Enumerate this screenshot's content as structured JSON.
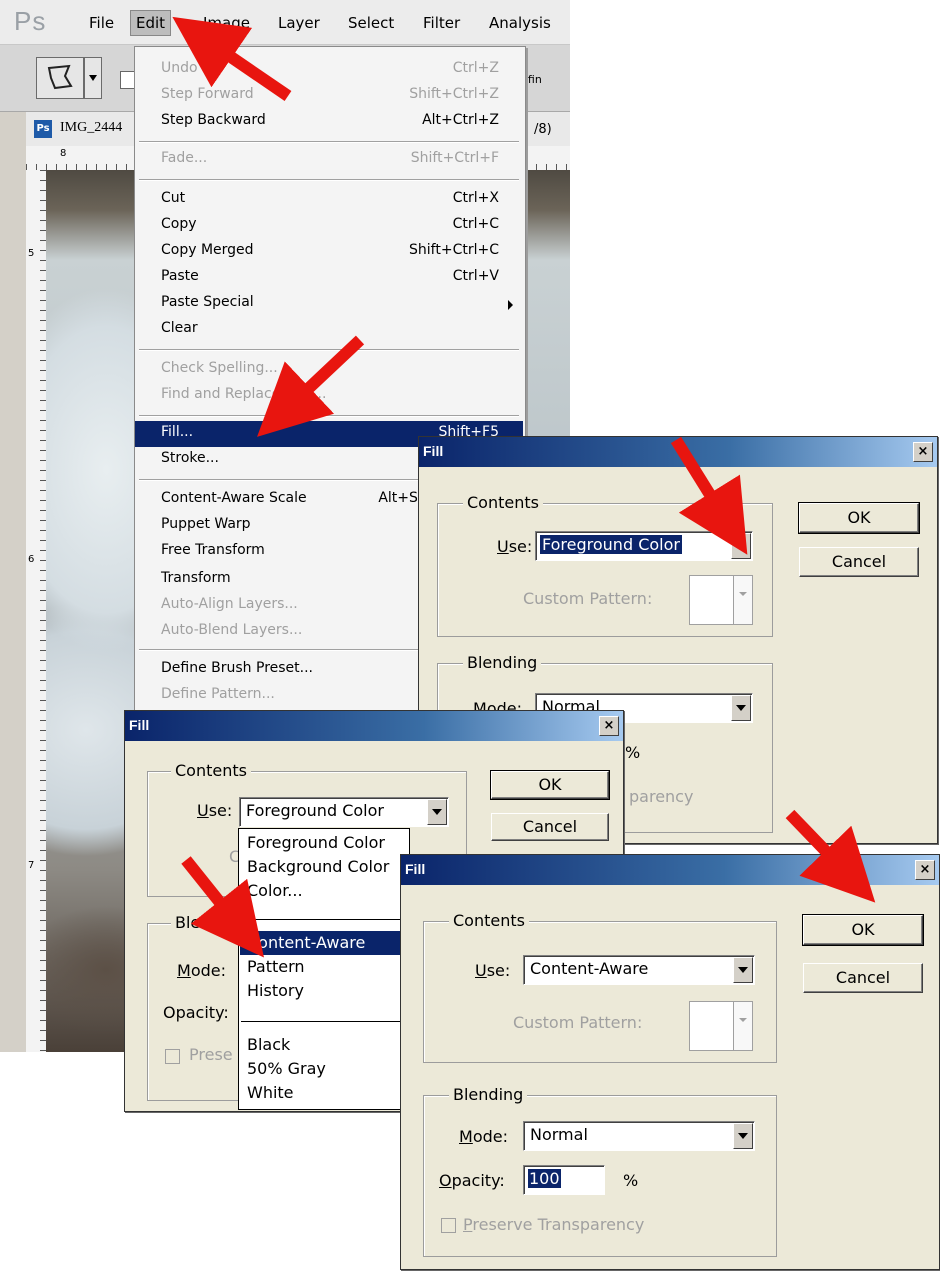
{
  "app": {
    "logo": "Ps",
    "menu": [
      "File",
      "Edit",
      "Image",
      "Layer",
      "Select",
      "Filter",
      "Analysis"
    ],
    "options_refine": "Refin",
    "doc_title": "IMG_2444",
    "doc_suffix": "/8)",
    "ruler_marks": [
      "8",
      "5",
      "6",
      "7"
    ]
  },
  "edit_menu": {
    "items": [
      {
        "label": "Undo",
        "shortcut": "Ctrl+Z",
        "disabled": true
      },
      {
        "label": "Step Forward",
        "shortcut": "Shift+Ctrl+Z",
        "disabled": true
      },
      {
        "label": "Step Backward",
        "shortcut": "Alt+Ctrl+Z",
        "disabled": false
      },
      {
        "label": "Fade...",
        "shortcut": "Shift+Ctrl+F",
        "disabled": true
      },
      {
        "label": "Cut",
        "shortcut": "Ctrl+X",
        "disabled": false
      },
      {
        "label": "Copy",
        "shortcut": "Ctrl+C",
        "disabled": false
      },
      {
        "label": "Copy Merged",
        "shortcut": "Shift+Ctrl+C",
        "disabled": false
      },
      {
        "label": "Paste",
        "shortcut": "Ctrl+V",
        "disabled": false
      },
      {
        "label": "Paste Special",
        "shortcut": "",
        "disabled": false
      },
      {
        "label": "Clear",
        "shortcut": "",
        "disabled": false
      },
      {
        "label": "Check Spelling...",
        "shortcut": "",
        "disabled": true
      },
      {
        "label": "Find and Replace Text...",
        "shortcut": "",
        "disabled": true
      },
      {
        "label": "Fill...",
        "shortcut": "Shift+F5",
        "disabled": false
      },
      {
        "label": "Stroke...",
        "shortcut": "",
        "disabled": false
      },
      {
        "label": "Content-Aware Scale",
        "shortcut": "Alt+Shift+Ctrl+C",
        "disabled": false
      },
      {
        "label": "Puppet Warp",
        "shortcut": "",
        "disabled": false
      },
      {
        "label": "Free Transform",
        "shortcut": "",
        "disabled": false
      },
      {
        "label": "Transform",
        "shortcut": "",
        "disabled": false
      },
      {
        "label": "Auto-Align Layers...",
        "shortcut": "",
        "disabled": true
      },
      {
        "label": "Auto-Blend Layers...",
        "shortcut": "",
        "disabled": true
      },
      {
        "label": "Define Brush Preset...",
        "shortcut": "",
        "disabled": false
      },
      {
        "label": "Define Pattern...",
        "shortcut": "",
        "disabled": true
      }
    ]
  },
  "fill_dialog_1": {
    "title": "Fill",
    "close": "×",
    "contents_legend": "Contents",
    "use_label": "Use:",
    "use_value": "Foreground Color",
    "custom_pattern_label": "Custom Pattern:",
    "blending_legend": "Blending",
    "mode_label": "Mode:",
    "mode_value": "Normal",
    "percent": "%",
    "preserve_partial": "parency",
    "ok": "OK",
    "cancel": "Cancel"
  },
  "fill_dialog_2": {
    "title": "Fill",
    "close": "×",
    "contents_legend": "Contents",
    "use_label": "Use:",
    "use_value": "Foreground Color",
    "blending_legend_partial": "Blendi",
    "mode_label": "Mode:",
    "opacity_label": "Opacity:",
    "preserve_partial": "Prese",
    "custom_partial": "C",
    "ok": "OK",
    "cancel": "Cancel",
    "options": [
      "Foreground Color",
      "Background Color",
      "Color...",
      "Content-Aware",
      "Pattern",
      "History",
      "Black",
      "50% Gray",
      "White"
    ],
    "selected_option": "Content-Aware"
  },
  "fill_dialog_3": {
    "title": "Fill",
    "close": "×",
    "contents_legend": "Contents",
    "use_label": "Use:",
    "use_value": "Content-Aware",
    "custom_pattern_label": "Custom Pattern:",
    "blending_legend": "Blending",
    "mode_label": "Mode:",
    "mode_value": "Normal",
    "opacity_label": "Opacity:",
    "opacity_value": "100",
    "percent": "%",
    "preserve_label": "Preserve Transparency",
    "ok": "OK",
    "cancel": "Cancel"
  },
  "colors": {
    "arrow": "#e8150f",
    "menu_highlight": "#0a246a"
  }
}
